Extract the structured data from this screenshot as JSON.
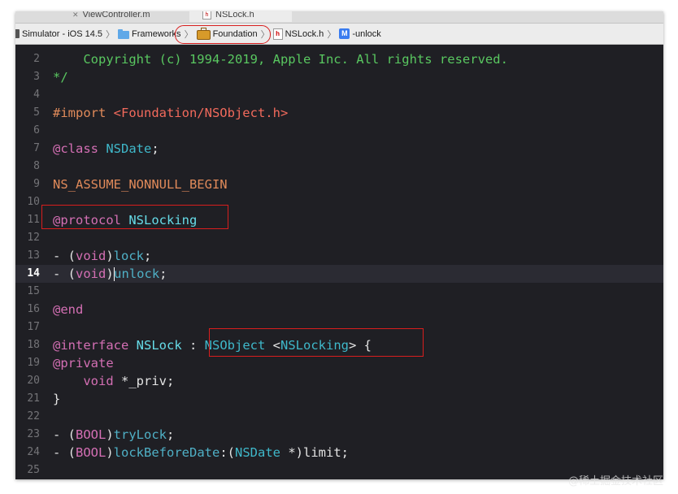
{
  "tabs": {
    "inactive_label": "ViewController.m",
    "active_label": "NSLock.h"
  },
  "breadcrumb": {
    "items": [
      {
        "icon": "simulator-icon",
        "label": "Simulator - iOS 14.5"
      },
      {
        "icon": "folder-icon",
        "label": "Frameworks"
      },
      {
        "icon": "toolbox-icon",
        "label": "Foundation"
      },
      {
        "icon": "header-file-icon",
        "label": "NSLock.h"
      },
      {
        "icon": "method-icon",
        "label": "-unlock"
      }
    ],
    "separator": "〉",
    "h_glyph": "h",
    "m_glyph": "M"
  },
  "editor": {
    "current_line": "14",
    "lines": [
      {
        "n": "2",
        "tokens": [
          {
            "c": "c-comment",
            "t": "    Copyright (c) 1994-2019, Apple Inc. All rights reserved."
          }
        ]
      },
      {
        "n": "3",
        "tokens": [
          {
            "c": "c-comment",
            "t": "*/"
          }
        ]
      },
      {
        "n": "4",
        "tokens": []
      },
      {
        "n": "5",
        "tokens": [
          {
            "c": "c-pre",
            "t": "#import "
          },
          {
            "c": "c-str",
            "t": "<Foundation/NSObject.h>"
          }
        ]
      },
      {
        "n": "6",
        "tokens": []
      },
      {
        "n": "7",
        "tokens": [
          {
            "c": "c-kw",
            "t": "@class"
          },
          {
            "c": "c-plain",
            "t": " "
          },
          {
            "c": "c-type",
            "t": "NSDate"
          },
          {
            "c": "c-plain",
            "t": ";"
          }
        ]
      },
      {
        "n": "8",
        "tokens": []
      },
      {
        "n": "9",
        "tokens": [
          {
            "c": "c-macro",
            "t": "NS_ASSUME_NONNULL_BEGIN"
          }
        ]
      },
      {
        "n": "10",
        "tokens": []
      },
      {
        "n": "11",
        "tokens": [
          {
            "c": "c-kw",
            "t": "@protocol"
          },
          {
            "c": "c-plain",
            "t": " "
          },
          {
            "c": "c-decl",
            "t": "NSLocking"
          }
        ]
      },
      {
        "n": "12",
        "tokens": []
      },
      {
        "n": "13",
        "tokens": [
          {
            "c": "c-plain",
            "t": "- ("
          },
          {
            "c": "c-kw",
            "t": "void"
          },
          {
            "c": "c-plain",
            "t": ")"
          },
          {
            "c": "c-method",
            "t": "lock"
          },
          {
            "c": "c-plain",
            "t": ";"
          }
        ]
      },
      {
        "n": "14",
        "tokens": [
          {
            "c": "c-plain",
            "t": "- ("
          },
          {
            "c": "c-kw",
            "t": "void"
          },
          {
            "c": "c-plain",
            "t": ")"
          },
          {
            "c": "cursor",
            "t": ""
          },
          {
            "c": "c-method",
            "t": "unlock"
          },
          {
            "c": "c-plain",
            "t": ";"
          }
        ]
      },
      {
        "n": "15",
        "tokens": []
      },
      {
        "n": "16",
        "tokens": [
          {
            "c": "c-kw",
            "t": "@end"
          }
        ]
      },
      {
        "n": "17",
        "tokens": []
      },
      {
        "n": "18",
        "tokens": [
          {
            "c": "c-kw",
            "t": "@interface"
          },
          {
            "c": "c-plain",
            "t": " "
          },
          {
            "c": "c-decl",
            "t": "NSLock"
          },
          {
            "c": "c-plain",
            "t": " : "
          },
          {
            "c": "c-type",
            "t": "NSObject"
          },
          {
            "c": "c-plain",
            "t": " <"
          },
          {
            "c": "c-type",
            "t": "NSLocking"
          },
          {
            "c": "c-plain",
            "t": "> {"
          }
        ]
      },
      {
        "n": "19",
        "tokens": [
          {
            "c": "c-kw",
            "t": "@private"
          }
        ]
      },
      {
        "n": "20",
        "tokens": [
          {
            "c": "c-plain",
            "t": "    "
          },
          {
            "c": "c-kw",
            "t": "void"
          },
          {
            "c": "c-plain",
            "t": " *_priv;"
          }
        ]
      },
      {
        "n": "21",
        "tokens": [
          {
            "c": "c-plain",
            "t": "}"
          }
        ]
      },
      {
        "n": "22",
        "tokens": []
      },
      {
        "n": "23",
        "tokens": [
          {
            "c": "c-plain",
            "t": "- ("
          },
          {
            "c": "c-kw",
            "t": "BOOL"
          },
          {
            "c": "c-plain",
            "t": ")"
          },
          {
            "c": "c-method",
            "t": "tryLock"
          },
          {
            "c": "c-plain",
            "t": ";"
          }
        ]
      },
      {
        "n": "24",
        "tokens": [
          {
            "c": "c-plain",
            "t": "- ("
          },
          {
            "c": "c-kw",
            "t": "BOOL"
          },
          {
            "c": "c-plain",
            "t": ")"
          },
          {
            "c": "c-method",
            "t": "lockBeforeDate"
          },
          {
            "c": "c-plain",
            "t": ":("
          },
          {
            "c": "c-type",
            "t": "NSDate"
          },
          {
            "c": "c-plain",
            "t": " *)limit;"
          }
        ]
      },
      {
        "n": "25",
        "tokens": []
      }
    ]
  },
  "watermark": "@稀土掘金技术社区",
  "colors": {
    "editor_bg": "#1f1f24",
    "comment": "#59c760",
    "keyword": "#d46fb4",
    "type": "#3fb8ca",
    "annotation_red": "#d81e1e"
  }
}
